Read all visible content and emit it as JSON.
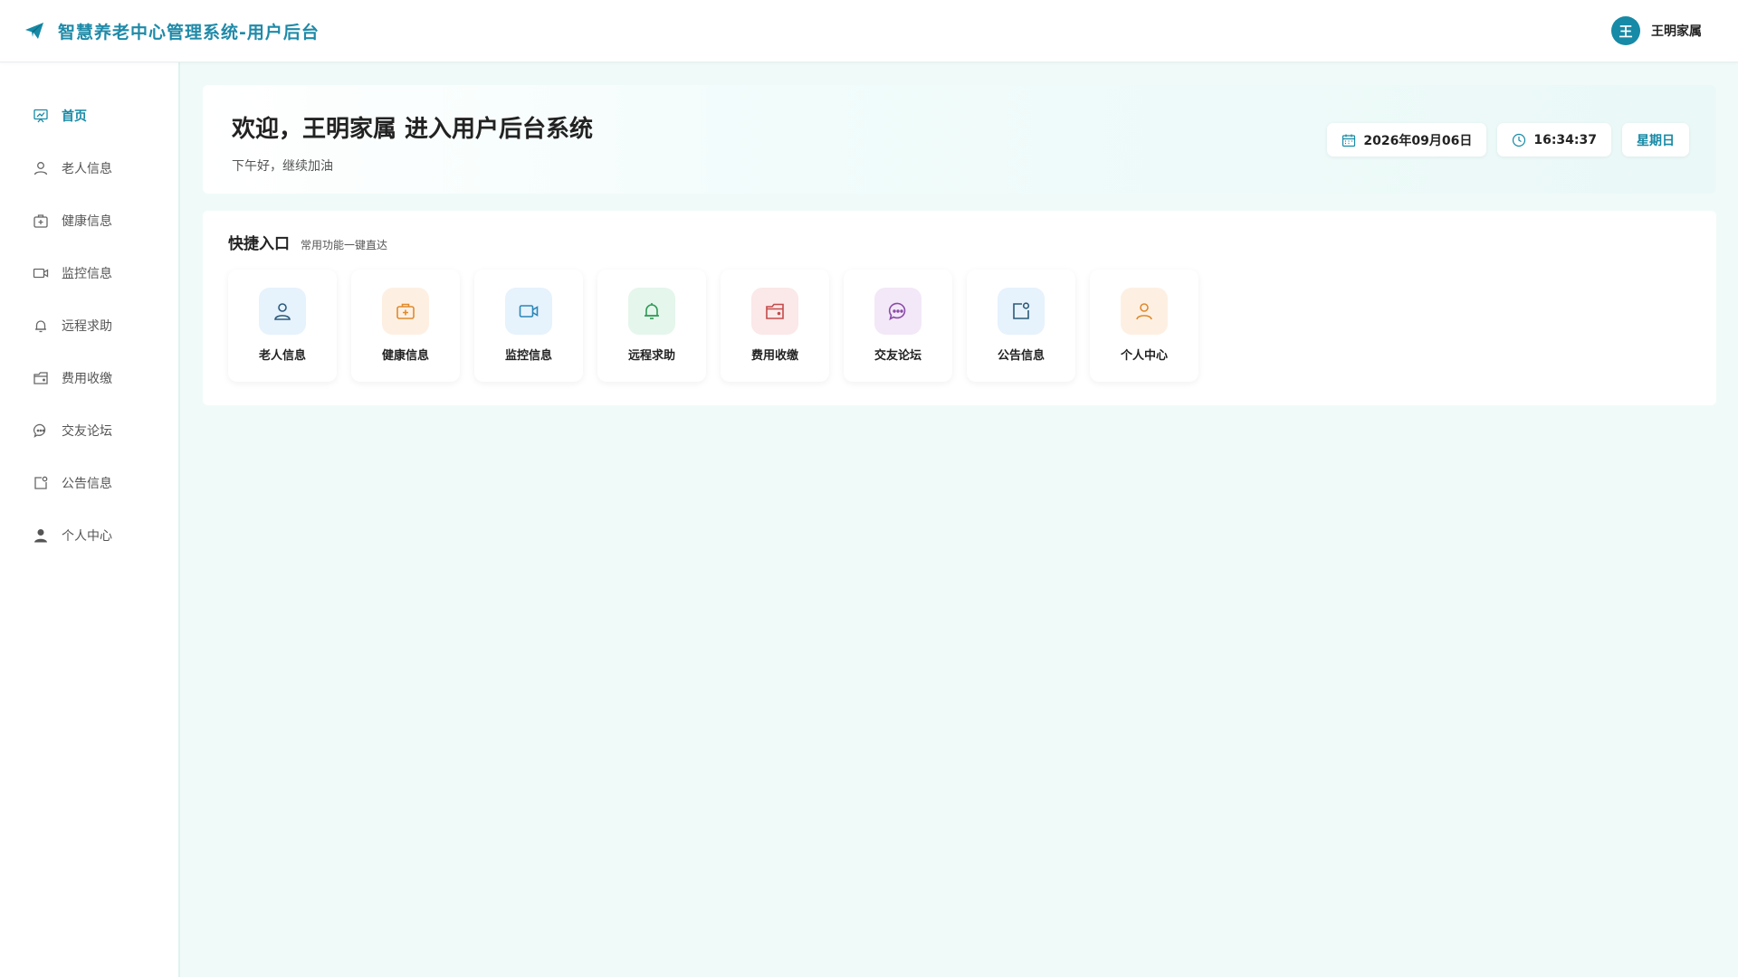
{
  "header": {
    "title": "智慧养老中心管理系统-用户后台",
    "user": {
      "avatar_char": "王",
      "name": "王明家属"
    }
  },
  "sidebar": {
    "items": [
      {
        "label": "首页",
        "icon": "dashboard-icon",
        "active": true
      },
      {
        "label": "老人信息",
        "icon": "user-icon"
      },
      {
        "label": "健康信息",
        "icon": "medical-kit-icon"
      },
      {
        "label": "监控信息",
        "icon": "video-camera-icon"
      },
      {
        "label": "远程求助",
        "icon": "bell-icon"
      },
      {
        "label": "费用收缴",
        "icon": "wallet-icon"
      },
      {
        "label": "交友论坛",
        "icon": "chat-icon"
      },
      {
        "label": "公告信息",
        "icon": "notice-icon"
      },
      {
        "label": "个人中心",
        "icon": "person-icon"
      }
    ]
  },
  "welcome": {
    "title": "欢迎，王明家属 进入用户后台系统",
    "subtitle": "下午好，继续加油",
    "date": "2026年09月06日",
    "time": "16:34:37",
    "weekday": "星期日"
  },
  "quick": {
    "title": "快捷入口",
    "subtitle": "常用功能一键直达",
    "tiles": [
      {
        "label": "老人信息",
        "icon": "user-icon",
        "bg": "#e6f2fc",
        "color": "#2a5a7a"
      },
      {
        "label": "健康信息",
        "icon": "medical-kit-icon",
        "bg": "#fdf0e3",
        "color": "#e08a2c"
      },
      {
        "label": "监控信息",
        "icon": "video-camera-icon",
        "bg": "#e6f2fc",
        "color": "#2a86b8"
      },
      {
        "label": "远程求助",
        "icon": "bell-icon",
        "bg": "#e5f6ec",
        "color": "#2e9a55"
      },
      {
        "label": "费用收缴",
        "icon": "wallet-icon",
        "bg": "#fbe8e8",
        "color": "#c44a4a"
      },
      {
        "label": "交友论坛",
        "icon": "chat-icon",
        "bg": "#f3e8f7",
        "color": "#8a4aa8"
      },
      {
        "label": "公告信息",
        "icon": "notice-icon",
        "bg": "#e6f2fc",
        "color": "#2a5a7a"
      },
      {
        "label": "个人中心",
        "icon": "person-icon",
        "bg": "#fdf0e3",
        "color": "#e08a2c"
      }
    ]
  },
  "colors": {
    "primary": "#168aa6",
    "brand_text": "#1f8aa8",
    "page_bg": "#f0fbf9"
  }
}
